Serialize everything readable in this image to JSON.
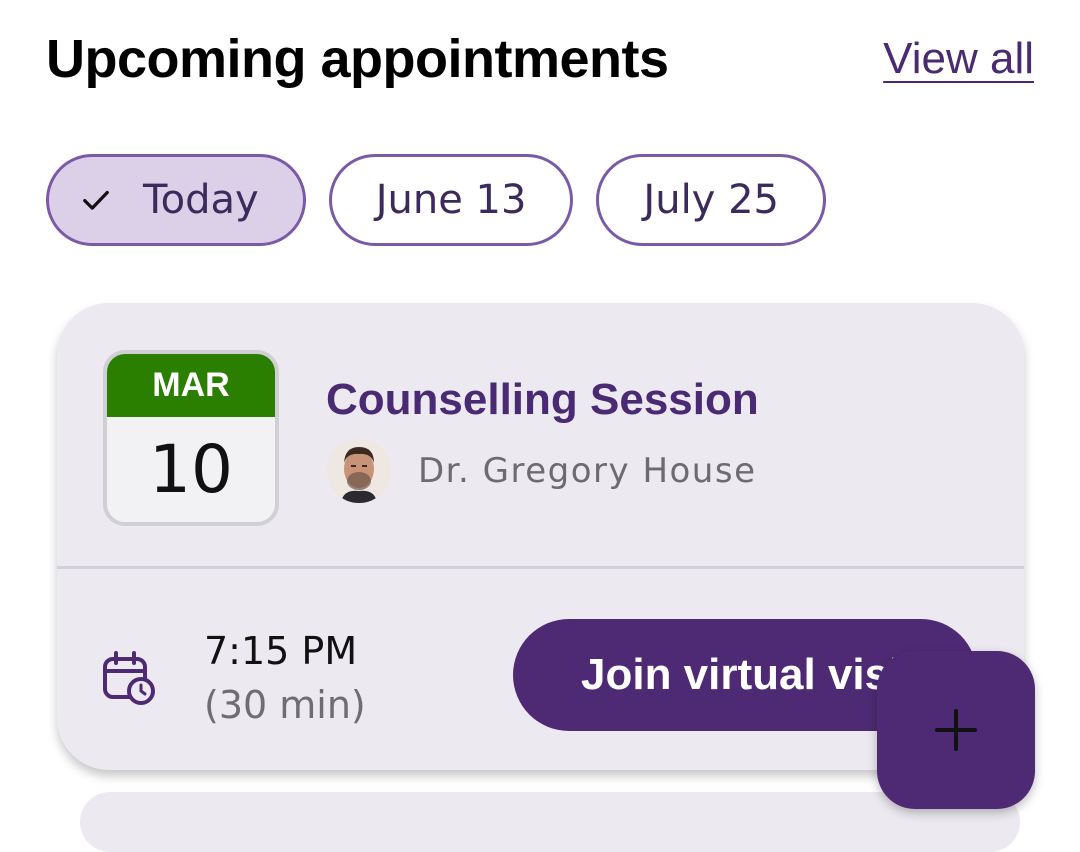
{
  "header": {
    "title": "Upcoming appointments",
    "view_all_label": "View all"
  },
  "filters": {
    "chips": [
      {
        "label": "Today",
        "selected": true,
        "icon": "check-icon"
      },
      {
        "label": "June 13",
        "selected": false
      },
      {
        "label": "July 25",
        "selected": false
      }
    ]
  },
  "appointment": {
    "month": "MAR",
    "day": "10",
    "title": "Counselling Session",
    "doctor": "Dr. Gregory House",
    "avatar_icon": "doctor-avatar",
    "time": "7:15 PM",
    "duration": "(30 min)",
    "time_icon": "calendar-clock-icon",
    "join_label": "Join virtual visit"
  },
  "fab": {
    "icon": "plus-icon"
  },
  "colors": {
    "brand_purple": "#4e2a74",
    "chip_selected_bg": "#dccfe8",
    "month_green": "#2b7f00",
    "card_bg": "#ece9f0"
  }
}
